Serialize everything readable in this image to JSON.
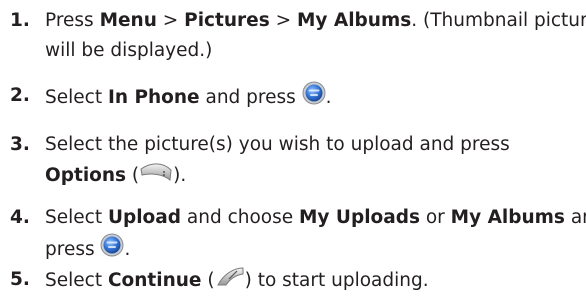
{
  "steps": [
    {
      "number": "1.",
      "line1": {
        "t1": "Press ",
        "menu": "Menu",
        "sep1": " > ",
        "pictures": "Pictures",
        "sep2": " > ",
        "albums": "My Albums",
        "t2": ". (Thumbnail pictures"
      },
      "line2": "will be displayed.)"
    },
    {
      "number": "2.",
      "t1": "Select ",
      "in_phone": "In Phone",
      "t2": " and press ",
      "icon": "menu-ok-key-icon",
      "t3": "."
    },
    {
      "number": "3.",
      "line1": "Select the picture(s) you wish to upload and press",
      "options": "Options",
      "open": " (",
      "icon": "right-softkey-icon",
      "close": ")."
    },
    {
      "number": "4.",
      "t1": "Select ",
      "upload": "Upload",
      "t2": " and choose ",
      "my_uploads": "My Uploads",
      "or": " or ",
      "my_albums": "My Albums",
      "and": " and",
      "press": "press ",
      "icon": "menu-ok-key-icon",
      "end": "."
    },
    {
      "number": "5.",
      "t1": "Select ",
      "continue": "Continue",
      "open": " (",
      "icon": "left-softkey-icon",
      "close": ") to start uploading."
    }
  ],
  "colors": {
    "text": "#231f20",
    "key_blue": "#2f6fd0",
    "key_ring": "#9aa0a6"
  }
}
